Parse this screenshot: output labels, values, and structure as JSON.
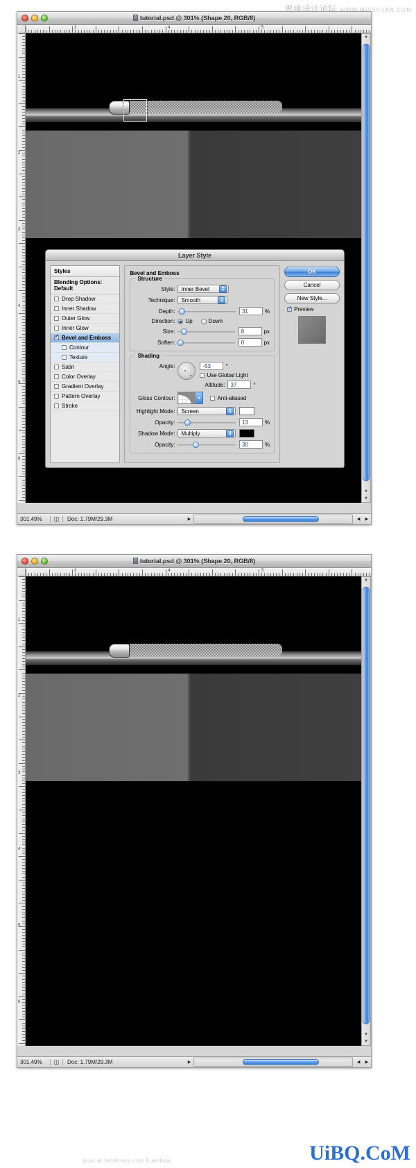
{
  "watermarks": {
    "top_cn": "思缘设计论坛",
    "top_url": "WWW.MISSYUAN.COM",
    "bottom": "UiBQ.CoM",
    "footer": "post at toonfrens.com A.anilara"
  },
  "window": {
    "title": "tutorial.psd @ 301% (Shape 20, RGB/8)",
    "traffic_lights": [
      "close-button",
      "minimize-button",
      "zoom-button"
    ],
    "status": {
      "zoom": "301.49%",
      "doc": "Doc: 1.79M/29.3M"
    },
    "ruler_labels_h": [
      "3",
      "4",
      "5"
    ],
    "ruler_labels_v": [
      "1",
      "2",
      "3",
      "4",
      "5",
      "6"
    ]
  },
  "dialog": {
    "title": "Layer Style",
    "styles_pane": {
      "header": "Styles",
      "blending_options": "Blending Options: Default",
      "items": [
        {
          "label": "Drop Shadow",
          "checked": false,
          "indent": false,
          "selected": false
        },
        {
          "label": "Inner Shadow",
          "checked": false,
          "indent": false,
          "selected": false
        },
        {
          "label": "Outer Glow",
          "checked": false,
          "indent": false,
          "selected": false
        },
        {
          "label": "Inner Glow",
          "checked": false,
          "indent": false,
          "selected": false
        },
        {
          "label": "Bevel and Emboss",
          "checked": true,
          "indent": false,
          "selected": true
        },
        {
          "label": "Contour",
          "checked": false,
          "indent": true,
          "selected": false
        },
        {
          "label": "Texture",
          "checked": false,
          "indent": true,
          "selected": false
        },
        {
          "label": "Satin",
          "checked": false,
          "indent": false,
          "selected": false
        },
        {
          "label": "Color Overlay",
          "checked": false,
          "indent": false,
          "selected": false
        },
        {
          "label": "Gradient Overlay",
          "checked": false,
          "indent": false,
          "selected": false
        },
        {
          "label": "Pattern Overlay",
          "checked": false,
          "indent": false,
          "selected": false
        },
        {
          "label": "Stroke",
          "checked": false,
          "indent": false,
          "selected": false
        }
      ]
    },
    "section_title": "Bevel and Emboss",
    "structure": {
      "legend": "Structure",
      "style_label": "Style:",
      "style_value": "Inner Bevel",
      "technique_label": "Technique:",
      "technique_value": "Smooth",
      "depth_label": "Depth:",
      "depth_value": "31",
      "depth_unit": "%",
      "direction_label": "Direction:",
      "direction_up": "Up",
      "direction_down": "Down",
      "direction_selected": "Up",
      "size_label": "Size:",
      "size_value": "8",
      "size_unit": "px",
      "soften_label": "Soften:",
      "soften_value": "0",
      "soften_unit": "px"
    },
    "shading": {
      "legend": "Shading",
      "angle_label": "Angle:",
      "angle_value": "-53",
      "angle_unit": "°",
      "global_light_label": "Use Global Light",
      "global_light_checked": false,
      "altitude_label": "Altitude:",
      "altitude_value": "37",
      "altitude_unit": "°",
      "gloss_contour_label": "Gloss Contour:",
      "anti_aliased_label": "Anti-aliased",
      "anti_aliased_checked": false,
      "highlight_mode_label": "Highlight Mode:",
      "highlight_mode_value": "Screen",
      "highlight_color": "#ffffff",
      "highlight_opacity_label": "Opacity:",
      "highlight_opacity_value": "13",
      "highlight_opacity_unit": "%",
      "shadow_mode_label": "Shadow Mode:",
      "shadow_mode_value": "Multiply",
      "shadow_color": "#000000",
      "shadow_opacity_label": "Opacity:",
      "shadow_opacity_value": "30",
      "shadow_opacity_unit": "%"
    },
    "buttons": {
      "ok": "OK",
      "cancel": "Cancel",
      "new_style": "New Style...",
      "preview_label": "Preview",
      "preview_checked": true
    }
  }
}
